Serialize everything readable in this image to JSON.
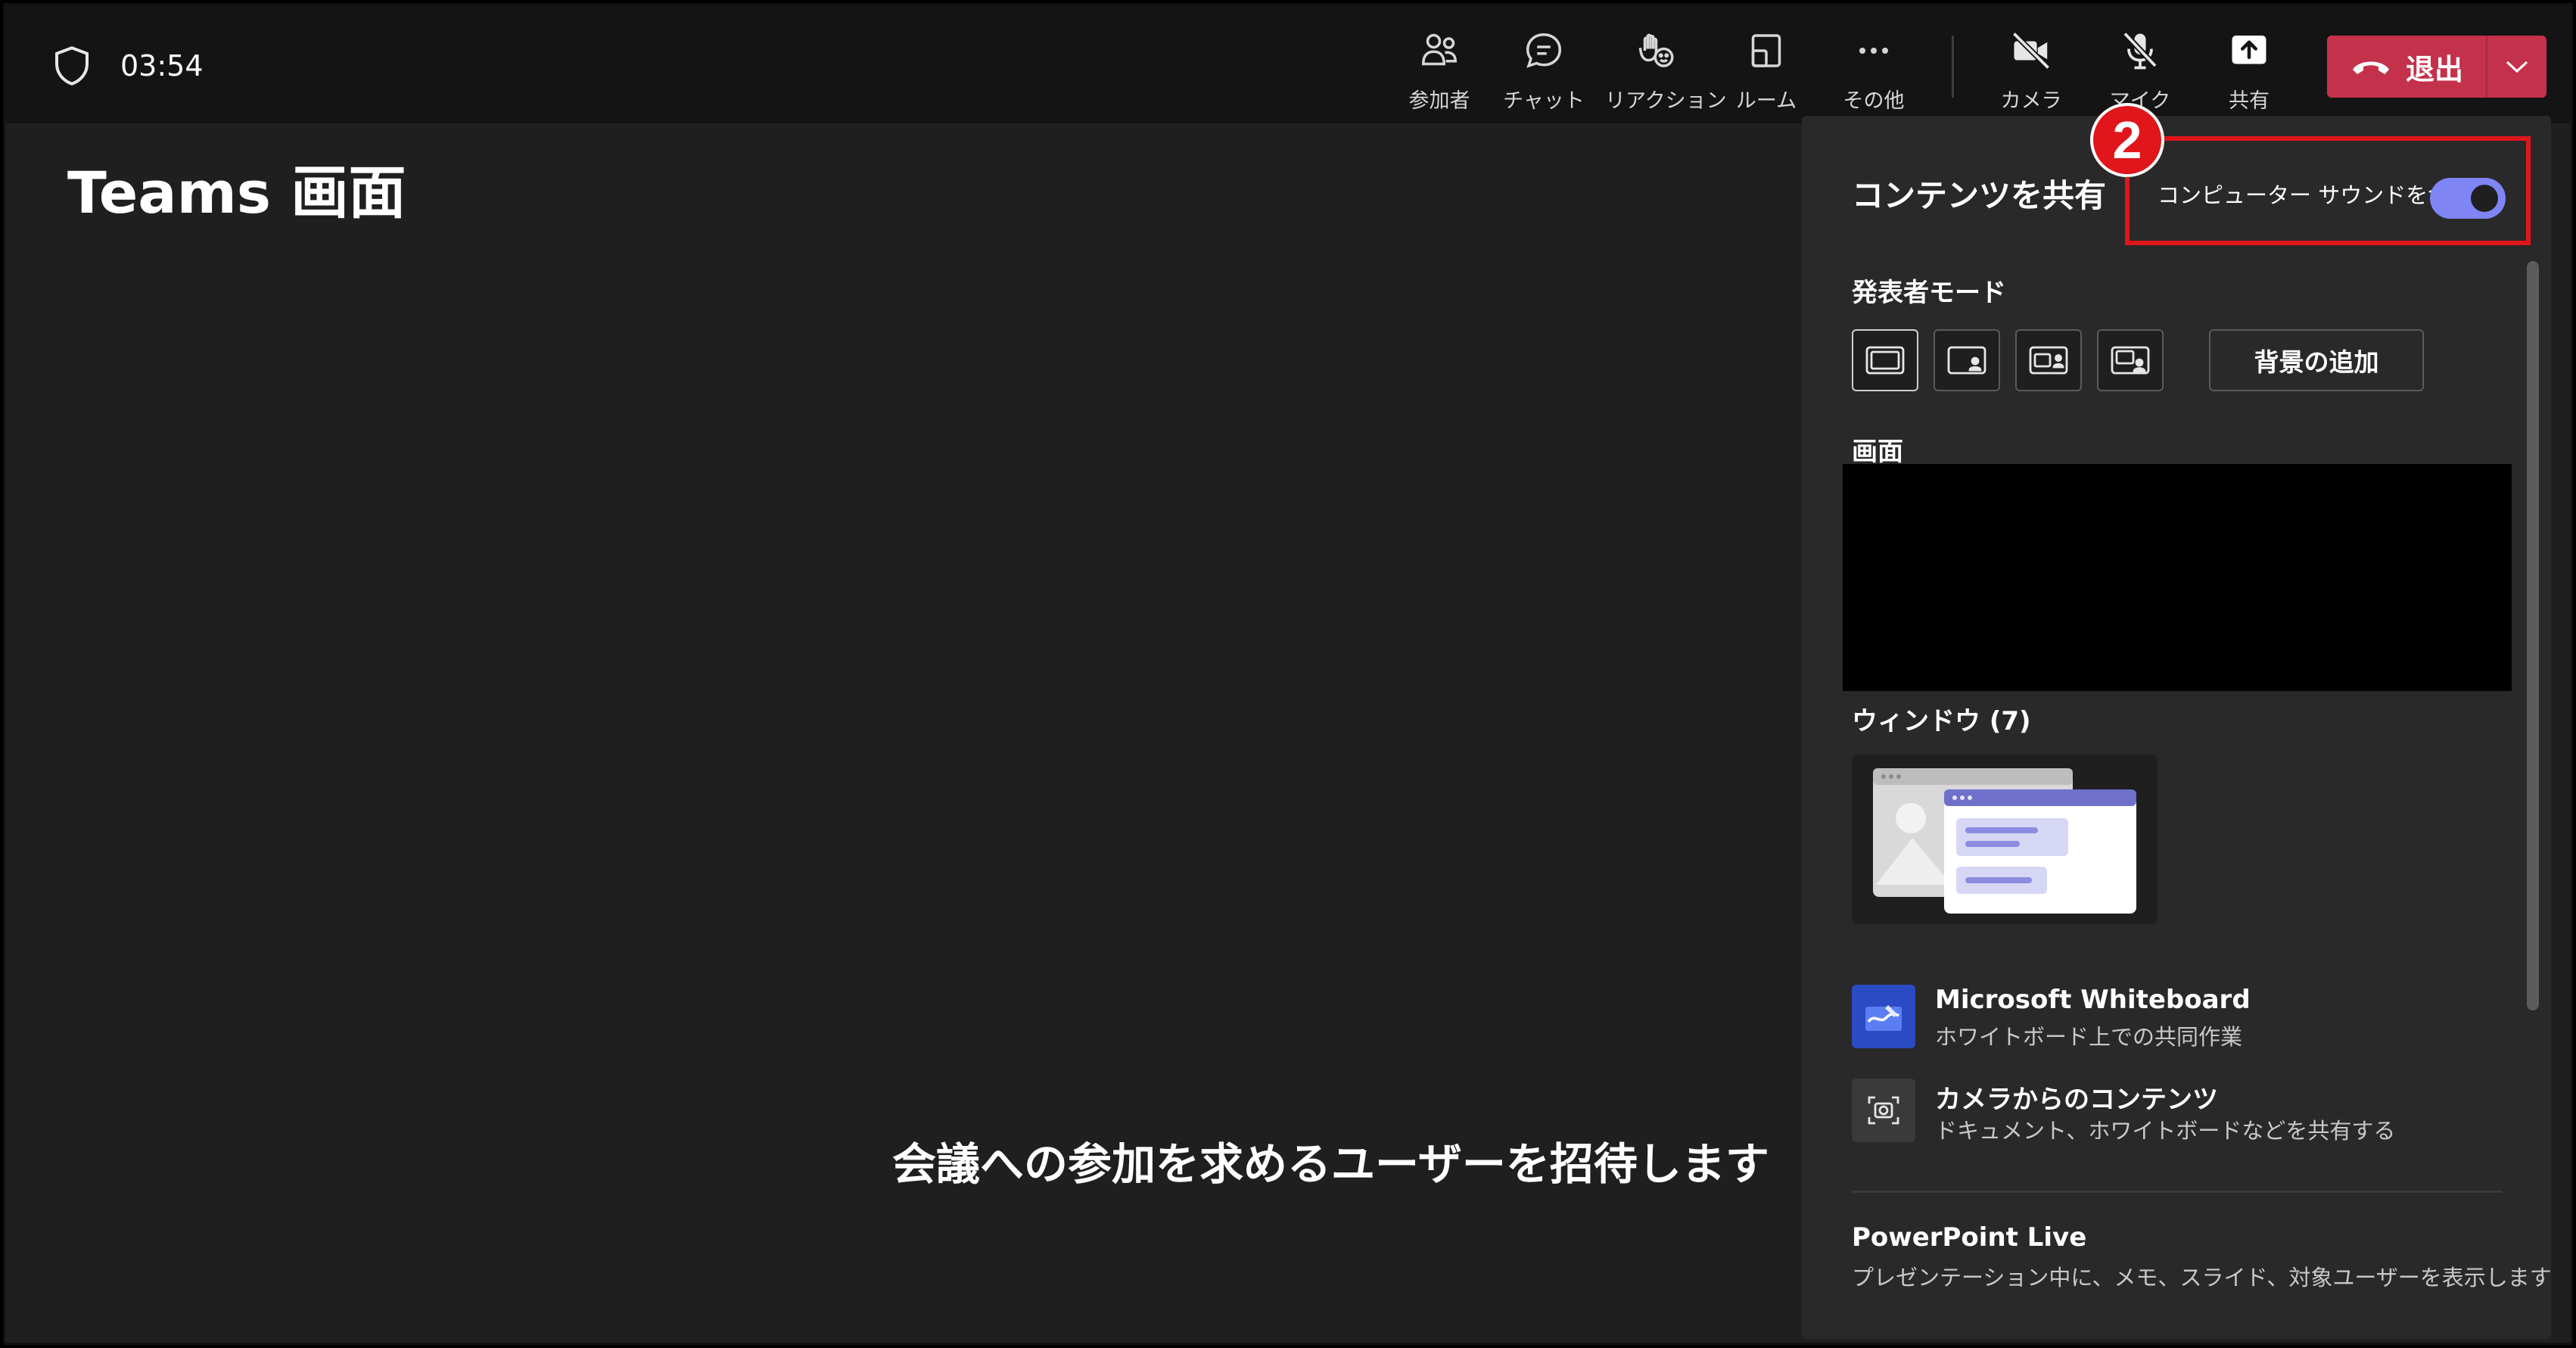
{
  "header": {
    "timer": "03:54",
    "toolbar": [
      {
        "id": "participants",
        "label": "参加者",
        "icon": "people-icon"
      },
      {
        "id": "chat",
        "label": "チャット",
        "icon": "chat-icon"
      },
      {
        "id": "reactions",
        "label": "リアクション",
        "icon": "reaction-icon"
      },
      {
        "id": "rooms",
        "label": "ルーム",
        "icon": "rooms-icon"
      },
      {
        "id": "more",
        "label": "その他",
        "icon": "more-icon"
      },
      {
        "id": "camera",
        "label": "カメラ",
        "icon": "camera-off-icon"
      },
      {
        "id": "mic",
        "label": "マイク",
        "icon": "mic-off-icon"
      },
      {
        "id": "share",
        "label": "共有",
        "icon": "share-icon"
      }
    ],
    "leave_label": "退出"
  },
  "main": {
    "screen_title": "Teams 画面",
    "invite_text": "会議への参加を求めるユーザーを招待します"
  },
  "share_panel": {
    "title": "コンテンツを共有",
    "include_sound_label": "コンピューター サウンドを含む",
    "include_sound_on": true,
    "presenter_mode_label": "発表者モード",
    "add_background_label": "背景の追加",
    "screen_label": "画面",
    "window_label": "ウィンドウ (7)",
    "apps": [
      {
        "name": "Microsoft Whiteboard",
        "desc": "ホワイトボード上での共同作業"
      },
      {
        "name": "カメラからのコンテンツ",
        "desc": "ドキュメント、ホワイトボードなどを共有する"
      }
    ],
    "powerpoint": {
      "name": "PowerPoint Live",
      "desc": "プレゼンテーション中に、メモ、スライド、対象ユーザーを表示します"
    }
  },
  "annotation": {
    "number": "2"
  },
  "colors": {
    "accent": "#7f85f5",
    "leave": "#c4314b",
    "callout": "#e0161b"
  }
}
